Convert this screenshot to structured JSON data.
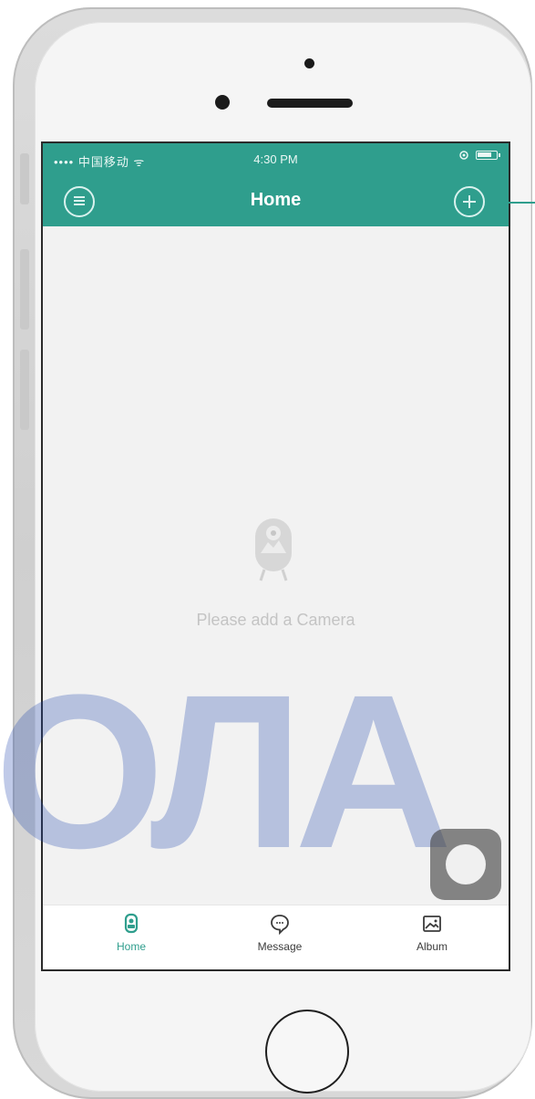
{
  "status_bar": {
    "carrier": "•••• 中国移动 ᯤ",
    "time": "4:30 PM",
    "battery_icon": "battery-icon"
  },
  "nav": {
    "title": "Home",
    "menu_icon": "menu-icon",
    "add_icon": "add-icon"
  },
  "content": {
    "empty_state_text": "Please add a Camera",
    "illustration_icon": "camera-icon"
  },
  "tabs": [
    {
      "label": "Home",
      "icon": "camera-tab-icon",
      "active": true
    },
    {
      "label": "Message",
      "icon": "message-icon",
      "active": false
    },
    {
      "label": "Album",
      "icon": "album-icon",
      "active": false
    }
  ],
  "watermark": "ОЛА",
  "colors": {
    "accent": "#2f9e8d",
    "background": "#f2f2f2"
  }
}
